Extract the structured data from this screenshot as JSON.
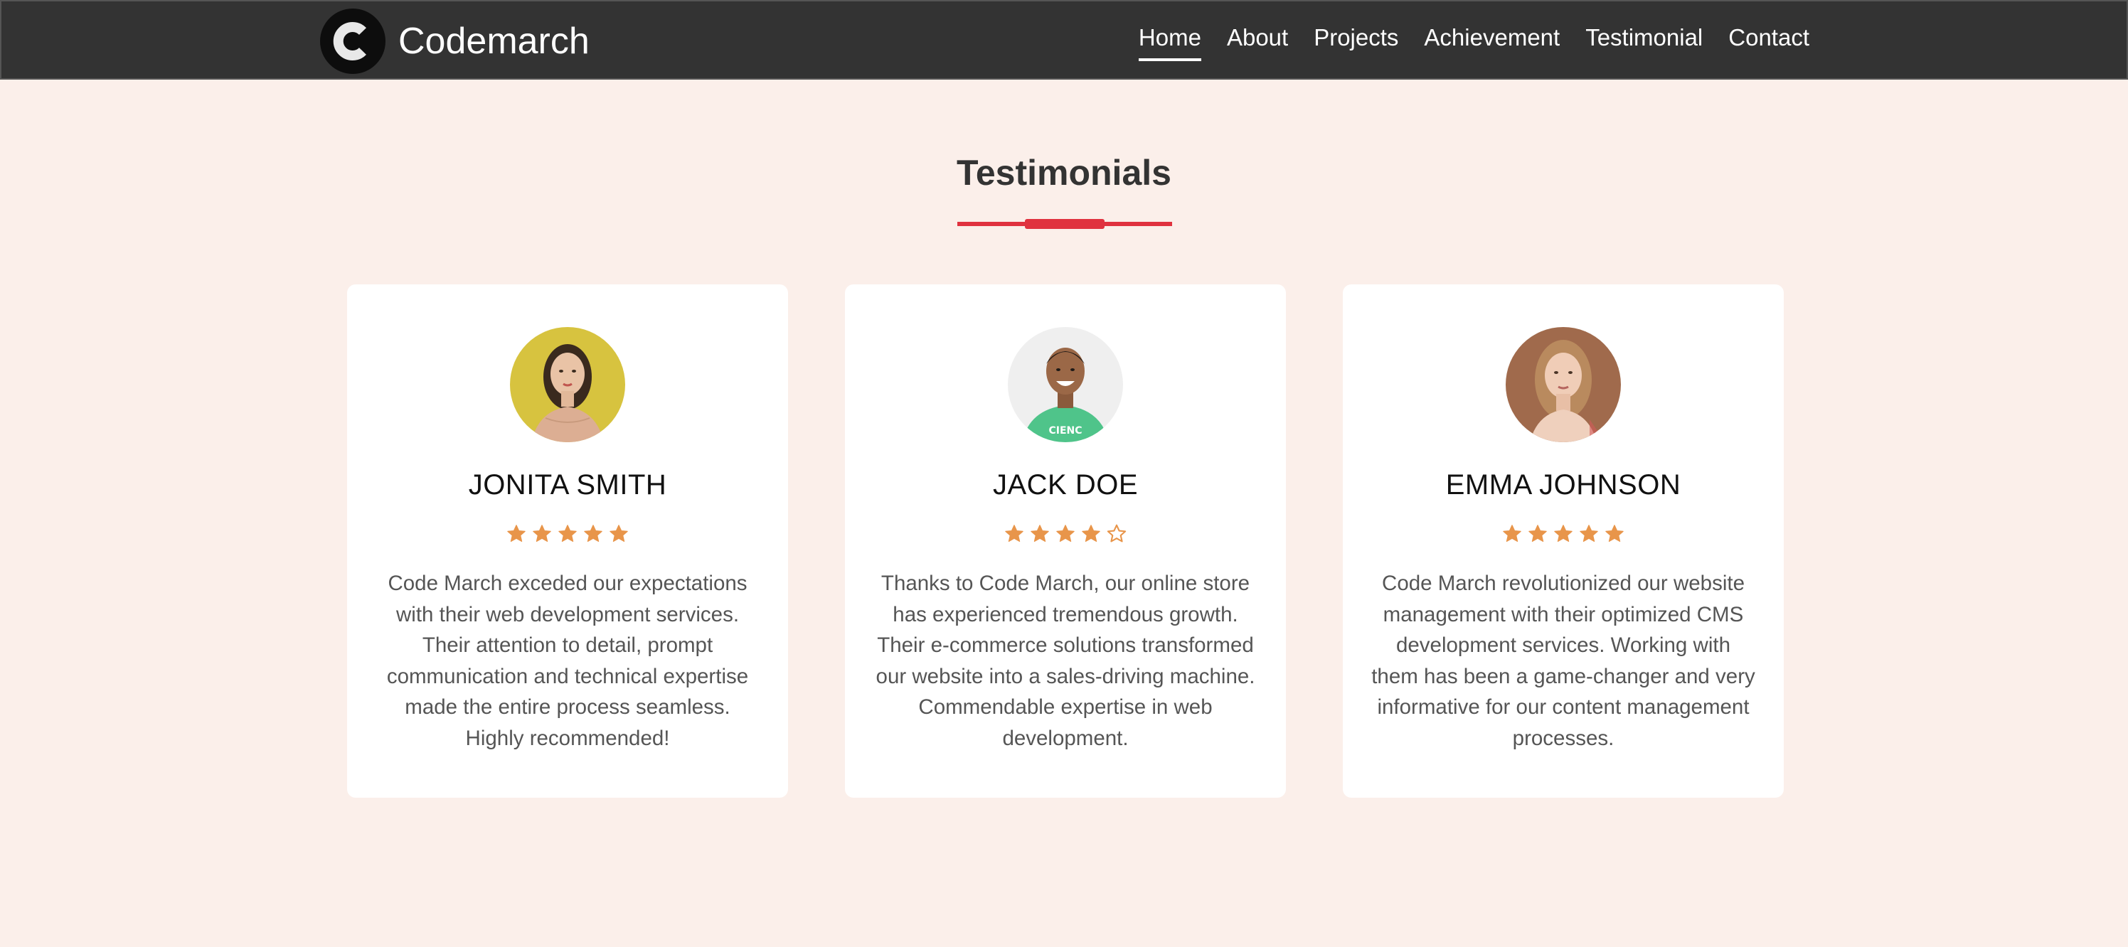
{
  "brand": {
    "name": "Codemarch",
    "logo_icon": "letter-c-logo-icon"
  },
  "nav": {
    "items": [
      {
        "label": "Home",
        "active": true
      },
      {
        "label": "About",
        "active": false
      },
      {
        "label": "Projects",
        "active": false
      },
      {
        "label": "Achievement",
        "active": false
      },
      {
        "label": "Testimonial",
        "active": false
      },
      {
        "label": "Contact",
        "active": false
      }
    ]
  },
  "section": {
    "title": "Testimonials"
  },
  "testimonials": [
    {
      "name": "JONITA SMITH",
      "rating": 5,
      "max_rating": 5,
      "text": "Code March exceded our expectations with their web development services. Their attention to detail, prompt communication and technical expertise made the entire process seamless. Highly recommended!"
    },
    {
      "name": "JACK DOE",
      "rating": 4,
      "max_rating": 5,
      "text": "Thanks to Code March, our online store has experienced tremendous growth. Their e-commerce solutions transformed our website into a sales-driving machine. Commendable expertise in web development."
    },
    {
      "name": "EMMA JOHNSON",
      "rating": 5,
      "max_rating": 5,
      "text": "Code March revolutionized our website management with their optimized CMS development services. Working with them has been a game-changer and very informative for our content management processes."
    }
  ],
  "colors": {
    "navbar_bg": "#333333",
    "page_bg": "#fbefea",
    "accent_red": "#e0323f",
    "star_orange": "#e8954a"
  }
}
